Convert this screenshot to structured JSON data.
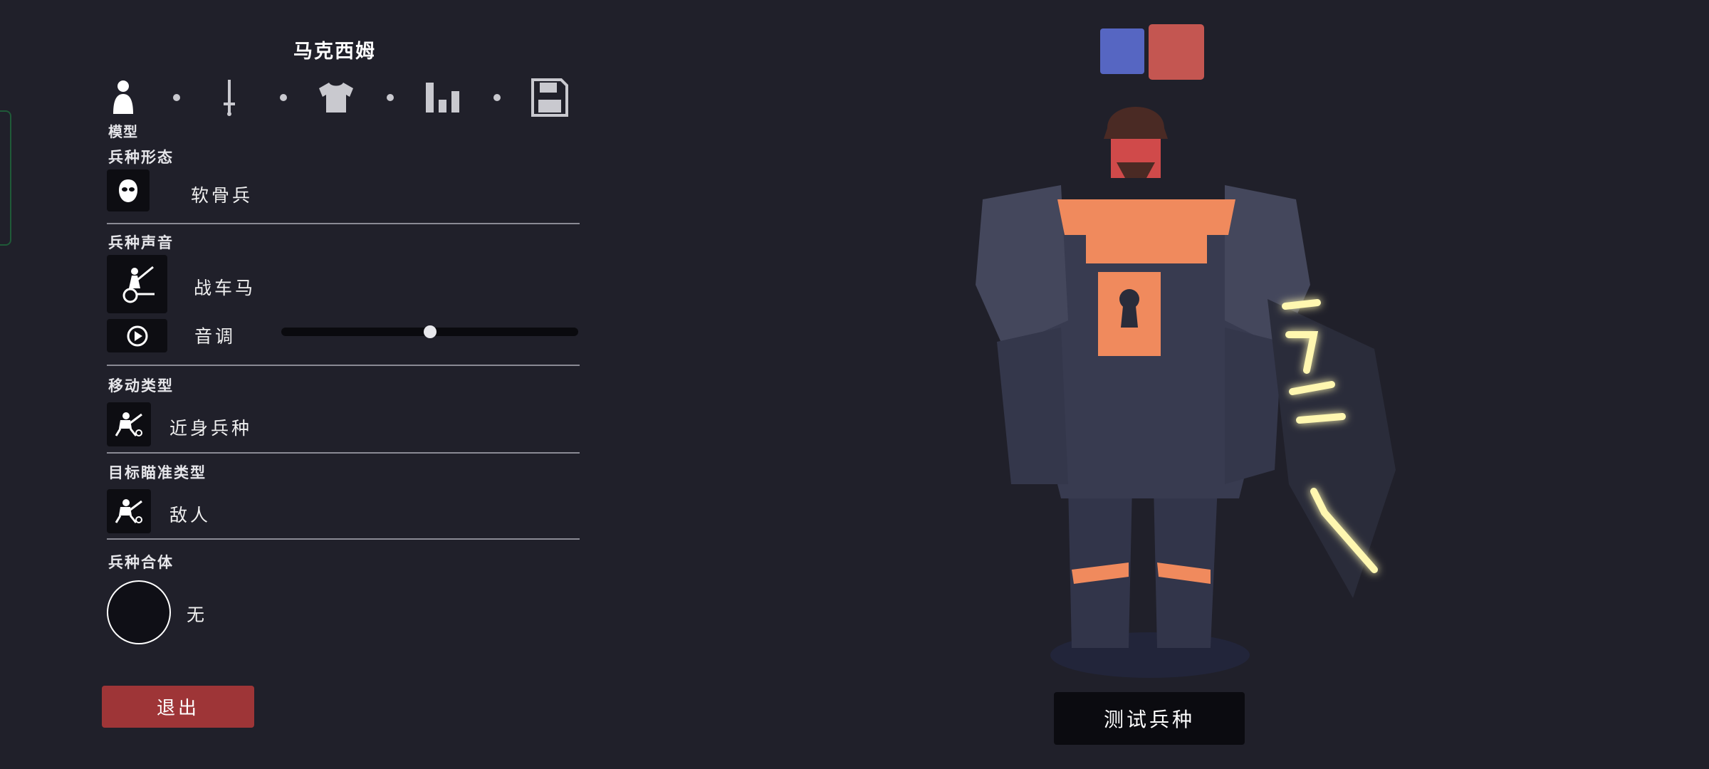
{
  "unit_name": "马克西姆",
  "tabs": [
    {
      "icon": "person-icon"
    },
    {
      "icon": "sword-icon"
    },
    {
      "icon": "shirt-icon"
    },
    {
      "icon": "bar-chart-icon"
    },
    {
      "icon": "save-icon"
    }
  ],
  "active_tab_label": "模型",
  "sections": {
    "form": {
      "title": "兵种形态",
      "value": "软骨兵",
      "icon": "mask-icon"
    },
    "voice": {
      "title": "兵种声音",
      "value": "战车马",
      "icon": "chariot-icon",
      "pitch_label": "音调",
      "pitch_value": 0.5,
      "play_icon": "play-icon"
    },
    "movement": {
      "title": "移动类型",
      "value": "近身兵种",
      "icon": "melee-icon"
    },
    "targeting": {
      "title": "目标瞄准类型",
      "value": "敌人",
      "icon": "target-icon"
    },
    "merge": {
      "title": "兵种合体",
      "value": "无"
    }
  },
  "buttons": {
    "exit": "退出",
    "test_unit": "测试兵种"
  },
  "teams": [
    {
      "name": "blue-team",
      "color": "#5666c2"
    },
    {
      "name": "red-team",
      "color": "#c45651"
    }
  ],
  "colors": {
    "background": "#20202a",
    "accent_red": "#9e3537",
    "armor_orange": "#f08a5d",
    "armor_dark": "#3a3d4d"
  }
}
